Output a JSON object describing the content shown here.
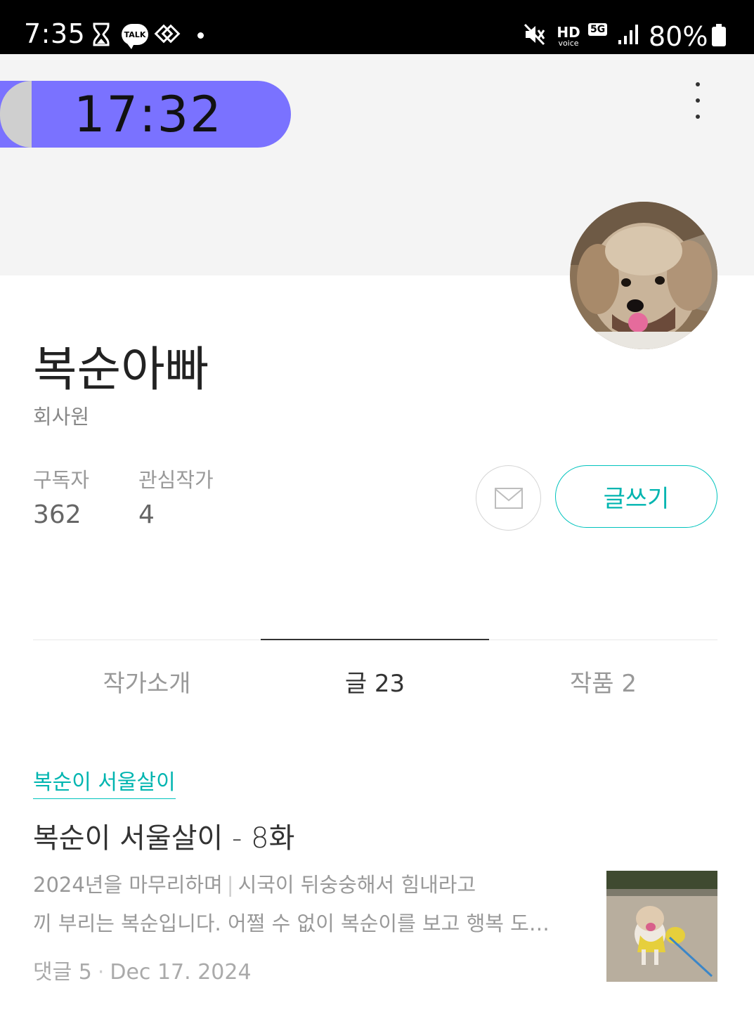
{
  "status_bar": {
    "time": "7:35",
    "talk_badge": "TALK",
    "hd": "HD",
    "voice": "voice",
    "network": "5G",
    "battery": "80%"
  },
  "cover": {
    "timer": "17:32"
  },
  "profile": {
    "name": "복순아빠",
    "job": "회사원",
    "stats": {
      "subscribers_label": "구독자",
      "subscribers_value": "362",
      "following_label": "관심작가",
      "following_value": "4"
    },
    "write_label": "글쓰기"
  },
  "tabs": [
    {
      "label": "작가소개"
    },
    {
      "label": "글 23"
    },
    {
      "label": "작품 2"
    }
  ],
  "article": {
    "magazine": "복순이 서울살이",
    "title": "복순이 서울살이 - 8화",
    "excerpt_lead": "2024년을 마무리하며",
    "excerpt_line1": "시국이 뒤숭숭해서 힘내라고",
    "excerpt_line2": "끼 부리는 복순입니다.  어쩔 수 없이 복순이를 보고 행복 도…",
    "comments": "댓글 5",
    "date": "Dec 17. 2024"
  }
}
